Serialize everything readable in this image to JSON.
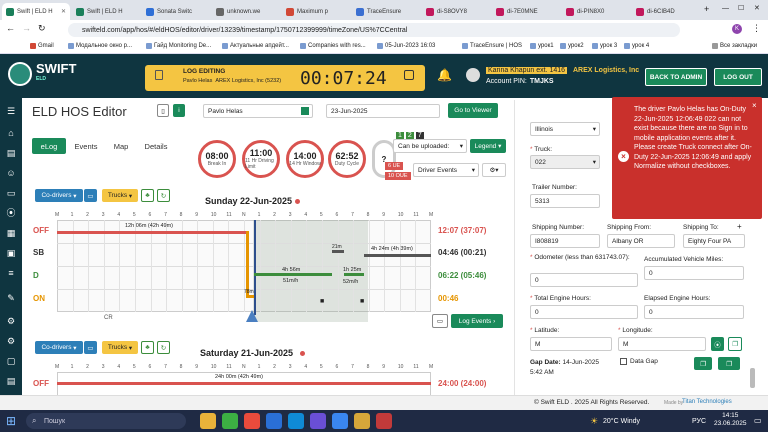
{
  "browser": {
    "tabs": [
      {
        "title": "Swift | ELD H",
        "color": "#1a7f5a",
        "active": true
      },
      {
        "title": "Swift | ELD H",
        "color": "#1a7f5a"
      },
      {
        "title": "Sonata Switc",
        "color": "#2f6fd6"
      },
      {
        "title": "unknown.we",
        "color": "#666666"
      },
      {
        "title": "Maximum p",
        "color": "#d14836"
      },
      {
        "title": "TraceEnsure",
        "color": "#3b6fd1"
      },
      {
        "title": "di-S8OVY8",
        "color": "#c2185b"
      },
      {
        "title": "di-7E0MNE",
        "color": "#c2185b"
      },
      {
        "title": "di-PIN8X0",
        "color": "#c2185b"
      },
      {
        "title": "di-6CIB4D",
        "color": "#c2185b"
      }
    ],
    "url": "swifteld.com/app/hos/#/eldHOS/editor/driver/13239/timestamp/1750712399999/timeZone/US%7CCentral",
    "bookmarks": [
      "Gmail",
      "Модальное окно р...",
      "Гайд Monitoring De...",
      "Актуальные апдейт...",
      "Companies with res...",
      "05-Jun-2023 16:03",
      "TraceEnsure | HOS",
      "урок1",
      "урок2",
      "урок 3",
      "урок 4",
      "Все закладки"
    ]
  },
  "header": {
    "logo": "SWIFT",
    "logo_sub": "ELD",
    "log_editing": "LOG EDITING",
    "driver_line": "Pavlo Helas",
    "company_line": "AREX Logistics, Inc (5232)",
    "timer": "00:07:24",
    "user_name": "Karina Khapun ext. 1416",
    "company": "AREX Logistics, Inc",
    "account_pin_label": "Account PIN:",
    "account_pin": "TMJKS",
    "back_to_admin": "BACK TO ADMIN",
    "logout": "LOG OUT"
  },
  "editor": {
    "title": "ELD HOS Editor",
    "driver": "Pavlo Helas",
    "date": "23-Jun-2025",
    "go_to_viewer": "Go to Viewer",
    "tabs": [
      "eLog",
      "Events",
      "Map",
      "Details"
    ],
    "circles": [
      {
        "value": "08:00",
        "label": "Break In"
      },
      {
        "value": "11:00",
        "label": "11 Hr Driving Limit"
      },
      {
        "value": "14:00",
        "label": "14 Hr Window"
      },
      {
        "value": "62:52",
        "label": "Duty Cycle"
      }
    ],
    "can_be_uploaded": "Can be uploaded:",
    "legend": "Legend",
    "driver_events": "Driver Events",
    "badge_nums": [
      "1",
      "2",
      "7"
    ],
    "ue_label": "6 UE",
    "oue_label": "10 OUE",
    "co_drivers": "Co-drivers",
    "trucks": "Trucks",
    "day1_title": "Sunday 22-Jun-2025",
    "day2_title": "Saturday 21-Jun-2025",
    "hours": [
      "M",
      "1",
      "2",
      "3",
      "4",
      "5",
      "6",
      "7",
      "8",
      "9",
      "10",
      "11",
      "N",
      "1",
      "2",
      "3",
      "4",
      "5",
      "6",
      "7",
      "8",
      "9",
      "10",
      "11",
      "M"
    ],
    "rows": [
      {
        "label": "OFF",
        "total": "12:07 (37:07)",
        "color": "#d9534f"
      },
      {
        "label": "SB",
        "total": "04:46 (00:21)",
        "color": "#333333"
      },
      {
        "label": "D",
        "total": "06:22 (05:46)",
        "color": "#3c8d3c"
      },
      {
        "label": "ON",
        "total": "00:46",
        "color": "#e69500"
      }
    ],
    "segments": {
      "off": "12h 06m (42h 49m)",
      "sb": "4h 24m (4h 39m)",
      "sb2": "21m",
      "d1": "4h 56m",
      "d1b": "51m/h",
      "d2": "1h 25m",
      "d2b": "52m/h",
      "on": "78m",
      "day2_off": "24h 00m (42h 49m)"
    },
    "cr_label": "CR",
    "log_events": "Log Events",
    "day2_total": "24:00 (24:00)"
  },
  "panel": {
    "state_value": "Illinois",
    "truck_label": "Truck:",
    "truck_value": "022",
    "trailer_label": "Trailer Number:",
    "trailer_value": "5313",
    "shipping_label": "Shipping Number:",
    "shipping_value": "I808819",
    "from_label": "Shipping From:",
    "from_value": "Albany OR",
    "to_label": "Shipping To:",
    "to_value": "Eighty Four PA",
    "odometer_label": "Odometer (less than 631743.07):",
    "odometer_value": "0",
    "acc_miles_label": "Accumulated Vehicle Miles:",
    "acc_miles_value": "0",
    "engine_label": "Total Engine Hours:",
    "engine_value": "0",
    "elapsed_label": "Elapsed Engine Hours:",
    "elapsed_value": "0",
    "lat_label": "Latitude:",
    "lat_value": "M",
    "lon_label": "Longitude:",
    "lon_value": "M",
    "gap_label": "Gap Date:",
    "gap_value": "14-Jun-2025 5:42 AM",
    "data_gap": "Data Gap"
  },
  "toast": {
    "message": "The driver Pavlo Helas has On-Duty 22-Jun-2025 12:06:49 022 can not exist because there are no Sign in to mobile application events after it. Please create Truck connect after On-Duty 22-Jun-2025 12:06:49 and apply Normalize without checkboxes."
  },
  "footer": {
    "copyright": "© Swift ELD . 2025 All Rights Reserved.",
    "made_by": "Made by",
    "titan": "Titan Technologies"
  },
  "taskbar": {
    "search": "Пошук",
    "weather": "20°C Windy",
    "lang": "РУС",
    "time": "14:15",
    "date": "23.06.2025"
  },
  "colors": {
    "header_bg": "#0f3540",
    "accent_green": "#1a8a5a",
    "toast_red": "#c9302c",
    "status_yellow": "#f4c542"
  }
}
